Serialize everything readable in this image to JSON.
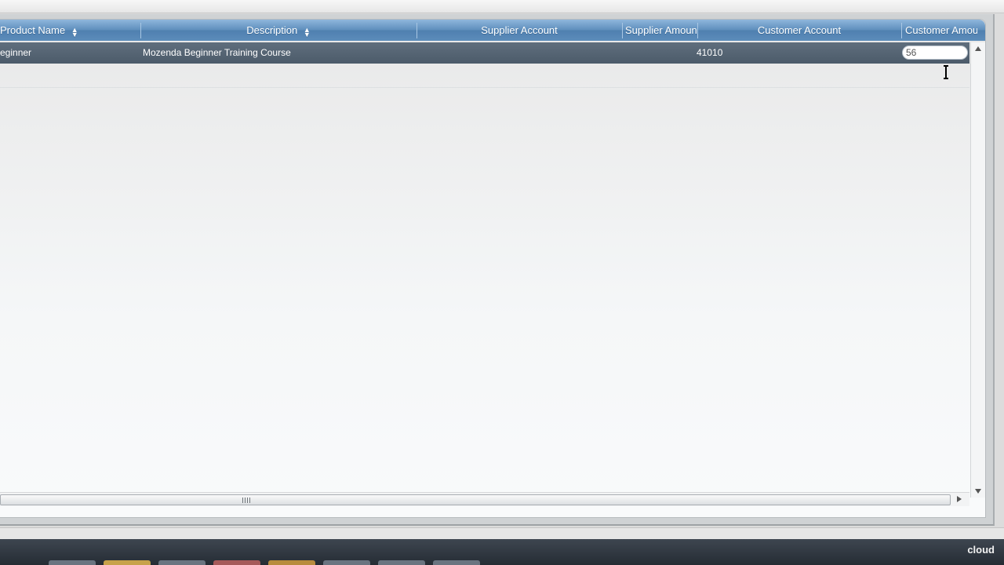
{
  "grid": {
    "columns": [
      {
        "label": "Product Name",
        "sortable": true
      },
      {
        "label": "Description",
        "sortable": true
      },
      {
        "label": "Supplier Account",
        "sortable": false
      },
      {
        "label": "Supplier Amoun",
        "sortable": false
      },
      {
        "label": "Customer Account",
        "sortable": false
      },
      {
        "label": "Customer Amou",
        "sortable": false
      }
    ],
    "row": {
      "product_name": "eginner",
      "description": "Mozenda Beginner Training Course",
      "supplier_account": "",
      "supplier_amount": "41010",
      "customer_account": "",
      "customer_amount": "56"
    }
  },
  "taskbar": {
    "label": "cloud"
  },
  "colors": {
    "header": "#5f8fbd",
    "row": "#55646f",
    "taskbar": "#2c333b"
  },
  "icons": [
    "sort-icon",
    "scroll-up-icon",
    "scroll-down-icon",
    "scroll-right-icon",
    "text-cursor-icon"
  ]
}
